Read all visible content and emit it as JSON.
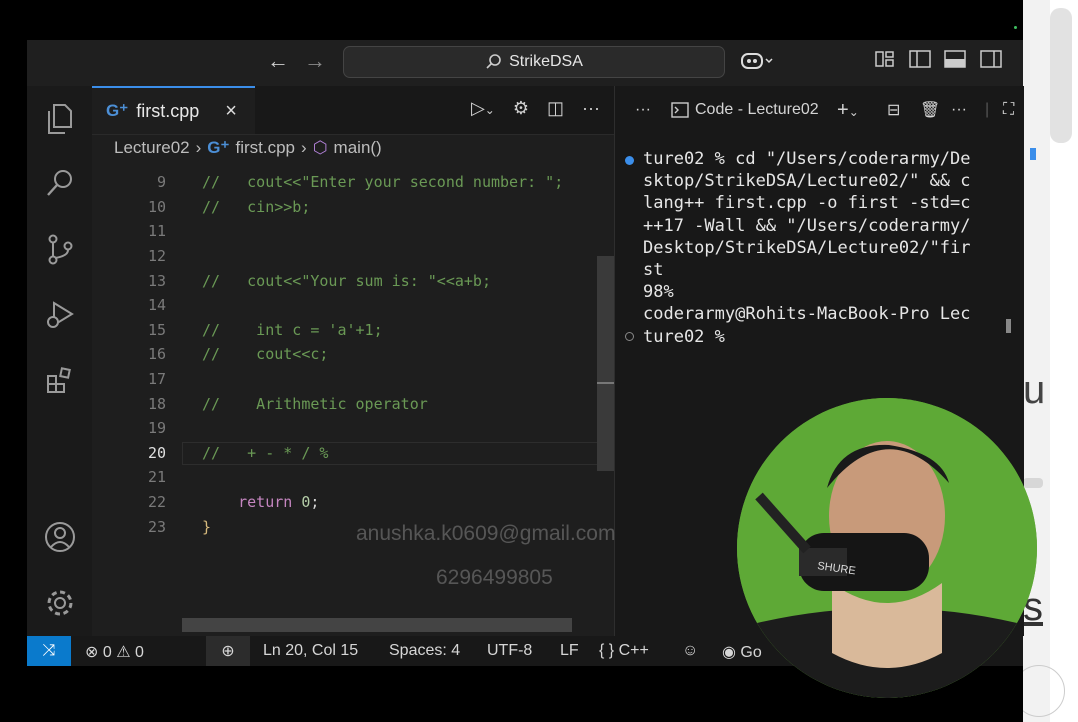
{
  "titlebar": {
    "back_icon": "arrow-left-icon",
    "forward_icon": "arrow-right-icon",
    "search_text": "StrikeDSA"
  },
  "tab": {
    "label": "first.cpp",
    "close": "×"
  },
  "breadcrumb": {
    "folder": "Lecture02",
    "file": "first.cpp",
    "symbol": "main()"
  },
  "code_lines": [
    {
      "n": "9",
      "text": "//   cout<<\"Enter your second number: \";"
    },
    {
      "n": "10",
      "text": "//   cin>>b;"
    },
    {
      "n": "11",
      "text": ""
    },
    {
      "n": "12",
      "text": ""
    },
    {
      "n": "13",
      "text": "//   cout<<\"Your sum is: \"<<a+b;"
    },
    {
      "n": "14",
      "text": ""
    },
    {
      "n": "15",
      "text": "//    int c = 'a'+1;"
    },
    {
      "n": "16",
      "text": "//    cout<<c;"
    },
    {
      "n": "17",
      "text": ""
    },
    {
      "n": "18",
      "text": "//    Arithmetic operator"
    },
    {
      "n": "19",
      "text": ""
    },
    {
      "n": "20",
      "text": "//   + - * / %"
    },
    {
      "n": "21",
      "text": ""
    },
    {
      "n": "22",
      "text": "    return 0;"
    },
    {
      "n": "23",
      "text": "}"
    }
  ],
  "terminal": {
    "title": "Code - Lecture02",
    "lines": [
      "ture02 % cd \"/Users/coderarmy/De",
      "sktop/StrikeDSA/Lecture02/\" && c",
      "lang++ first.cpp -o first -std=c",
      "++17 -Wall && \"/Users/coderarmy/",
      "Desktop/StrikeDSA/Lecture02/\"fir",
      "st",
      "98%",
      "coderarmy@Rohits-MacBook-Pro Lec",
      "ture02 % "
    ]
  },
  "status": {
    "errors": "0",
    "warnings": "0",
    "position": "Ln 20, Col 15",
    "spaces": "Spaces: 4",
    "encoding": "UTF-8",
    "eol": "LF",
    "language": "C++",
    "go_live": "Go"
  },
  "watermark": {
    "email": "anushka.k0609@gmail.com",
    "phone": "6296499805"
  },
  "right_side": {
    "text_u": "u",
    "text_s": "s"
  },
  "colors": {
    "accent": "#0a7acc",
    "comment": "#6a9955",
    "keyword": "#c586c0",
    "number": "#b5cea8",
    "webcam_bg": "#5ea936"
  }
}
